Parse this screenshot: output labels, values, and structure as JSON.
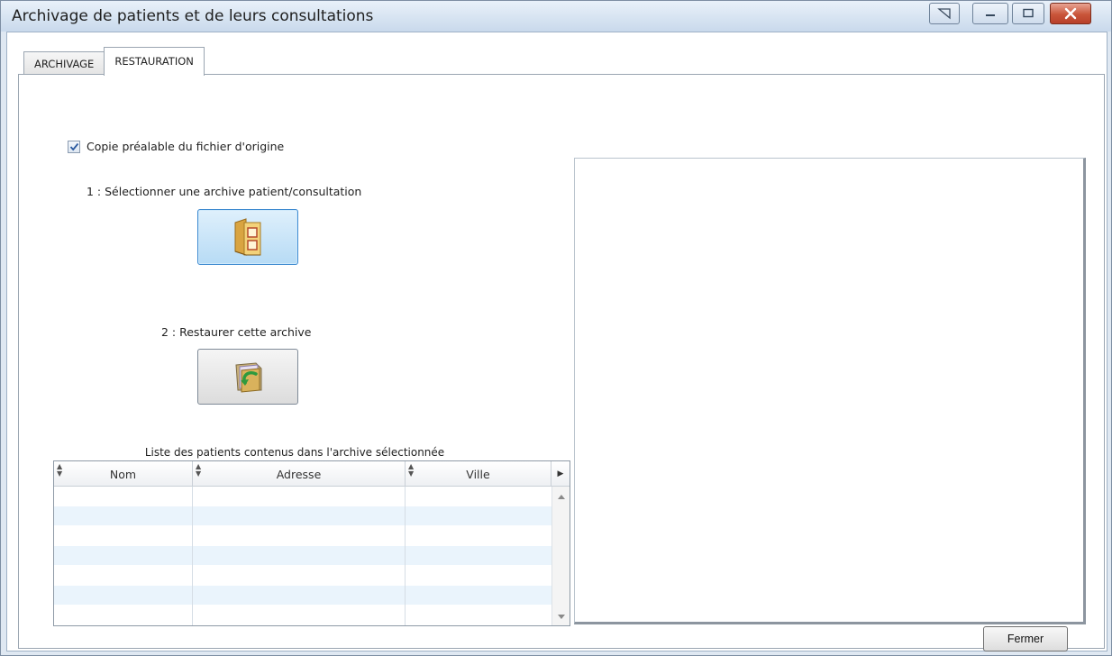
{
  "window": {
    "title": "Archivage de patients et de leurs consultations"
  },
  "tabs": [
    {
      "label": "ARCHIVAGE",
      "active": false
    },
    {
      "label": "RESTAURATION",
      "active": true
    }
  ],
  "restore": {
    "copy_checkbox_label": "Copie préalable du fichier d'origine",
    "copy_checked": true,
    "step1_label": "1 : Sélectionner une archive patient/consultation",
    "step2_label": "2 : Restaurer cette archive",
    "list_caption": "Liste des patients contenus dans l'archive sélectionnée",
    "columns": [
      "Nom",
      "Adresse",
      "Ville"
    ],
    "rows": []
  },
  "footer": {
    "close_label": "Fermer"
  },
  "icons": {
    "select_archive": "folder-select-icon",
    "restore_archive": "folder-restore-icon"
  }
}
